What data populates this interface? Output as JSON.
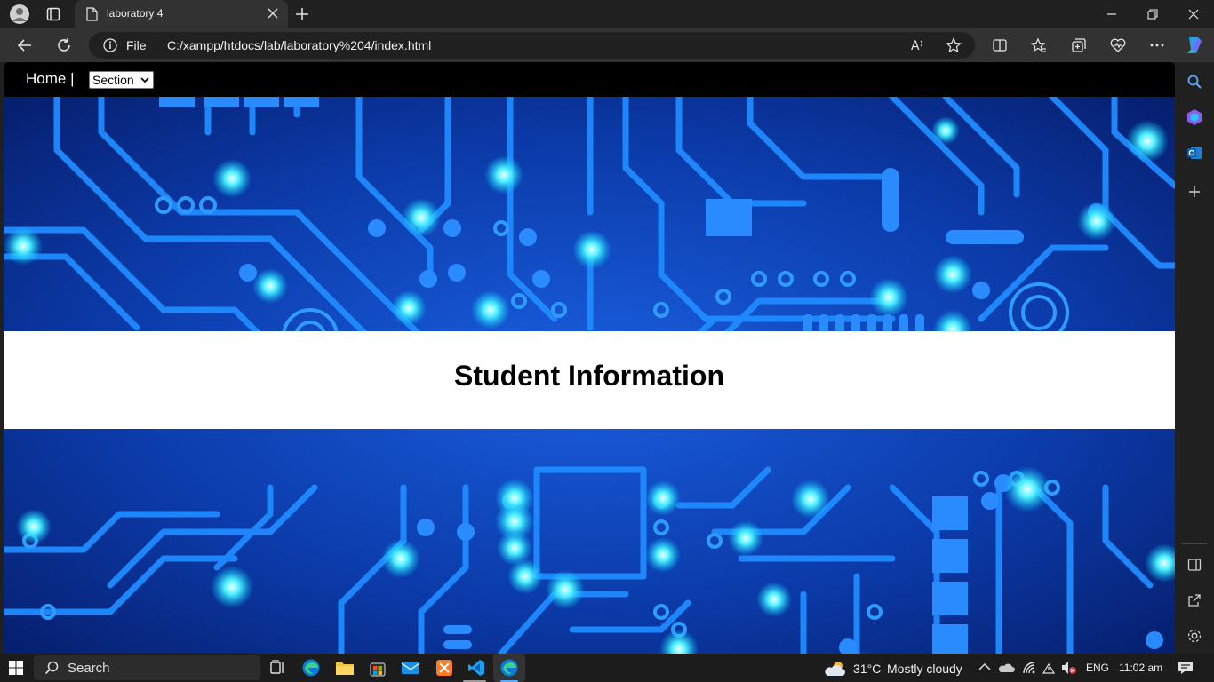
{
  "browser": {
    "tab_title": "laboratory 4",
    "address_prefix": "File",
    "url": "C:/xampp/htdocs/lab/laboratory%204/index.html"
  },
  "page": {
    "nav": {
      "home_label": "Home |",
      "select_value": "Section"
    },
    "heading": "Student Information"
  },
  "taskbar": {
    "search_label": "Search",
    "weather_temp": "31°C",
    "weather_text": "Mostly cloudy",
    "language": "ENG",
    "time": "11:02 am"
  },
  "colors": {
    "accent": "#1e90ff",
    "page_bg": "#0a2d8f",
    "nav_bg": "#000000"
  }
}
